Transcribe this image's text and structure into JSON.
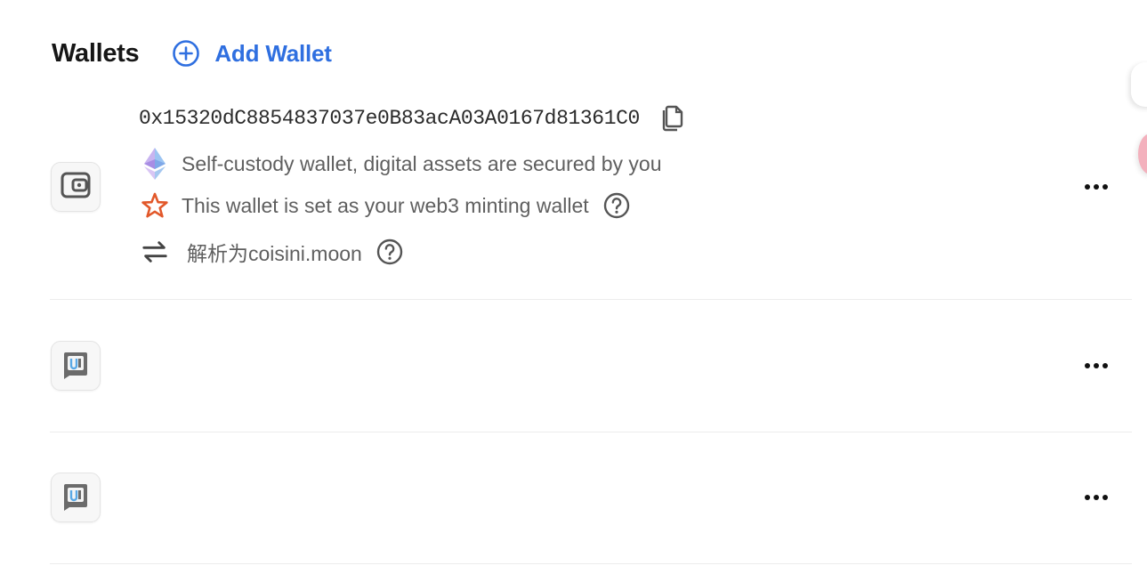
{
  "header": {
    "title": "Wallets",
    "add_wallet_label": "Add Wallet",
    "accent_color": "#2f6fe0"
  },
  "wallets": [
    {
      "avatar_icon": "wallet-icon",
      "address": "0x15320dC8854837037e0B83acA03A0167d81361C0",
      "copy_icon": "copy-icon",
      "type_text": "Self-custody wallet, digital assets are secured by you",
      "type_icon": "ethereum-icon",
      "mint_text": "This wallet is set as your web3 minting wallet",
      "mint_icon": "star-icon",
      "resolve_text": "解析为coisini.moon",
      "resolve_icon": "swap-arrows-icon",
      "more_icon": "more-icon"
    },
    {
      "avatar_icon": "app-wallet-icon",
      "more_icon": "more-icon"
    },
    {
      "avatar_icon": "app-wallet-icon",
      "more_icon": "more-icon"
    }
  ]
}
